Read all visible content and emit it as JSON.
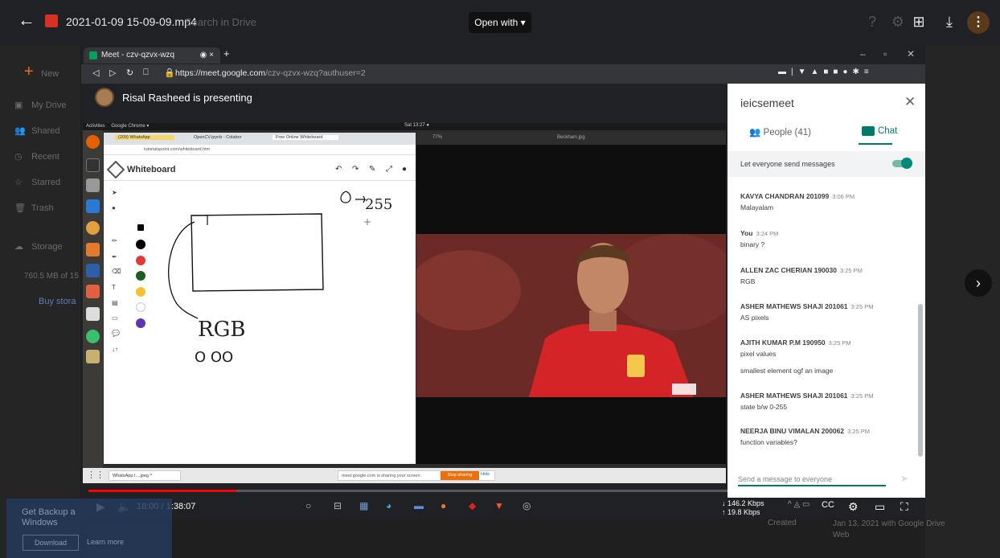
{
  "drive": {
    "file_title": "2021-01-09 15-09-09.mp4",
    "search_placeholder": "Search in Drive",
    "open_with_label": "Open with ▾",
    "sidebar": [
      {
        "label": "New",
        "icon": "plus-icon"
      },
      {
        "label": "My Drive",
        "icon": "drive-icon"
      },
      {
        "label": "Shared",
        "icon": "shared-icon"
      },
      {
        "label": "Recent",
        "icon": "clock-icon"
      },
      {
        "label": "Starred",
        "icon": "star-icon"
      },
      {
        "label": "Trash",
        "icon": "trash-icon"
      },
      {
        "label": "Storage",
        "icon": "cloud-icon"
      }
    ],
    "storage_text": "760.5 MB of 15",
    "buy_storage": "Buy stora",
    "backup_title": "Get Backup a",
    "backup_sub": "Windows",
    "download_label": "Download",
    "learn_more_label": "Learn more",
    "bottom_date": "Jan 13, 2021 with Google Drive",
    "bottom_web": "Web",
    "creator_label": "Created"
  },
  "browser": {
    "tab_title": "Meet - czv-qzvx-wzq",
    "url_host": "https://meet.google.com",
    "url_path": "/czv-qzvx-wzq?authuser=2"
  },
  "meet": {
    "presenter_text": "Risal Rasheed is presenting"
  },
  "inner_screen": {
    "activities": "Activities",
    "app_name": "Google Chrome ▾",
    "clock": "Sat 13:27 ●",
    "tabs": [
      "(209) WhatsApp",
      "OpenCV.ipynb - Colabor",
      "Free Online Whiteboard"
    ],
    "url": "tutorialspoint.com/whiteboard.htm",
    "whiteboard_title": "Whiteboard",
    "viewer_zoom": "77%",
    "viewer_file": "Beckham.jpg",
    "share_note": "meet.google.com is sharing your screen.",
    "stop_sharing": "Stop sharing",
    "hide": "Hide",
    "whatsapp_chip": "WhatsApp I....jpeg ^"
  },
  "chat": {
    "title": "ieicsemeet",
    "tab_people": "People (41)",
    "tab_chat": "Chat",
    "setting_label": "Let everyone send messages",
    "setting_on": true,
    "messages": [
      {
        "name": "KAVYA CHANDRAN 201099",
        "time": "3:06 PM",
        "text": "Malayalam"
      },
      {
        "name": "You",
        "time": "3:24 PM",
        "text": "binary ?"
      },
      {
        "name": "ALLEN ZAC CHERIAN 190030",
        "time": "3:25 PM",
        "text": "RGB"
      },
      {
        "name": "ASHER MATHEWS SHAJI 201061",
        "time": "3:25 PM",
        "text": "AS pixels"
      },
      {
        "name": "AJITH KUMAR P.M 190950",
        "time": "3:25 PM",
        "text": "pixel values"
      },
      {
        "name": "",
        "time": "",
        "text": "smallest element ogf an image"
      },
      {
        "name": "ASHER MATHEWS SHAJI 201061",
        "time": "3:25 PM",
        "text": "state b/w 0-255"
      },
      {
        "name": "NEERJA BINU VIMALAN 200062",
        "time": "3:25 PM",
        "text": "function variables?"
      }
    ],
    "input_placeholder": "Send a message to everyone"
  },
  "player": {
    "time": "18:00 / 1:38:07",
    "progress": 0.18,
    "net_down": "↓ 146.2 Kbps",
    "net_up": "↑ 19.8 Kbps"
  },
  "colors": {
    "accent_teal": "#00796b",
    "progress_red": "#ff0000",
    "drive_bg": "#202124"
  }
}
